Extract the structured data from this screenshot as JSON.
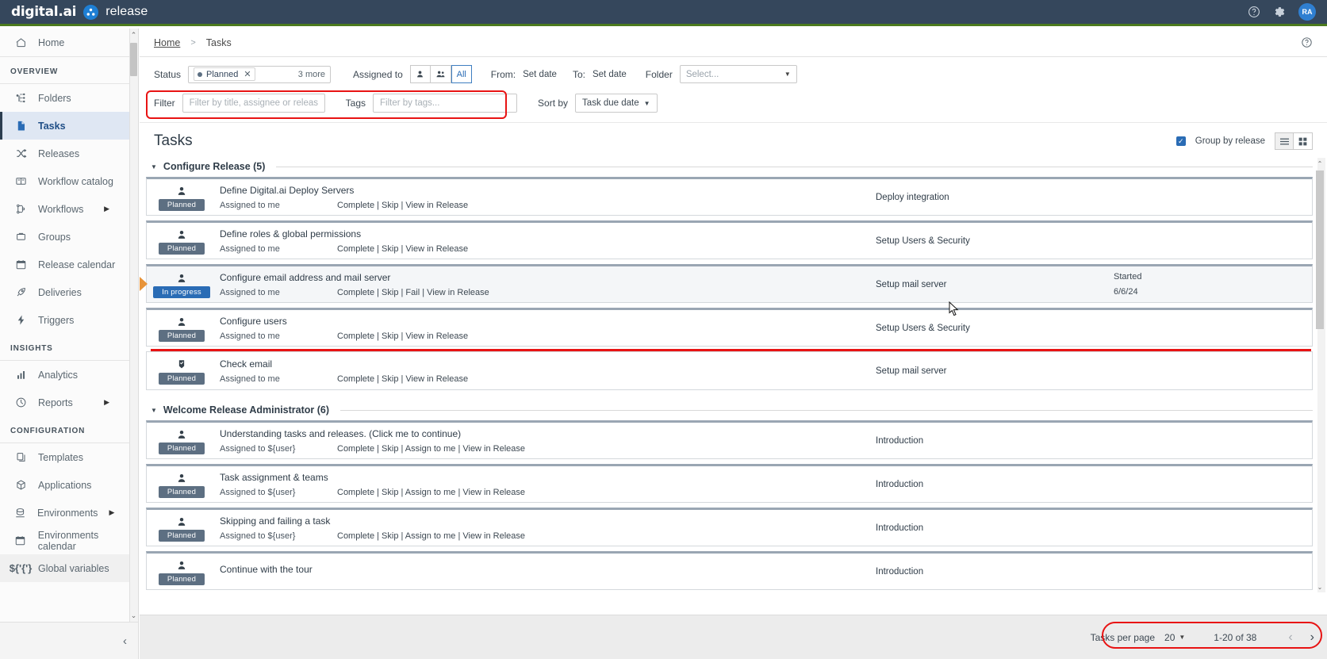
{
  "topbar": {
    "brand_primary": "digital.ai",
    "brand_product": "release",
    "icons": {
      "help": "help-icon",
      "settings": "gear-icon"
    },
    "avatar_initials": "RA"
  },
  "sidebar": {
    "home_label": "Home",
    "sections": [
      {
        "title": "OVERVIEW",
        "items": [
          {
            "label": "Folders",
            "icon": "folders-icon",
            "active": false,
            "expandable": false
          },
          {
            "label": "Tasks",
            "icon": "tasks-icon",
            "active": true,
            "expandable": false
          },
          {
            "label": "Releases",
            "icon": "releases-icon",
            "active": false,
            "expandable": false
          },
          {
            "label": "Workflow catalog",
            "icon": "book-icon",
            "active": false,
            "expandable": false
          },
          {
            "label": "Workflows",
            "icon": "workflows-icon",
            "active": false,
            "expandable": true
          },
          {
            "label": "Groups",
            "icon": "groups-icon",
            "active": false,
            "expandable": false
          },
          {
            "label": "Release calendar",
            "icon": "calendar-icon",
            "active": false,
            "expandable": false
          },
          {
            "label": "Deliveries",
            "icon": "rocket-icon",
            "active": false,
            "expandable": false
          },
          {
            "label": "Triggers",
            "icon": "bolt-icon",
            "active": false,
            "expandable": false
          }
        ]
      },
      {
        "title": "INSIGHTS",
        "items": [
          {
            "label": "Analytics",
            "icon": "bar-chart-icon",
            "active": false,
            "expandable": false
          },
          {
            "label": "Reports",
            "icon": "report-icon",
            "active": false,
            "expandable": true
          }
        ]
      },
      {
        "title": "CONFIGURATION",
        "items": [
          {
            "label": "Templates",
            "icon": "templates-icon",
            "active": false,
            "expandable": false
          },
          {
            "label": "Applications",
            "icon": "cube-icon",
            "active": false,
            "expandable": false
          },
          {
            "label": "Environments",
            "icon": "environments-icon",
            "active": false,
            "expandable": true
          },
          {
            "label": "Environments calendar",
            "icon": "calendar-icon",
            "active": false,
            "expandable": false
          },
          {
            "label": "Global variables",
            "icon": "variables-icon",
            "active": false,
            "expandable": false
          }
        ]
      }
    ],
    "collapse_icon": "chevron-left-icon"
  },
  "breadcrumb": {
    "home": "Home",
    "separator": ">",
    "current": "Tasks",
    "help_icon": "help-icon"
  },
  "filters": {
    "status_label": "Status",
    "status_chip": "Planned",
    "status_more": "3 more",
    "assigned_label": "Assigned to",
    "assigned_options": [
      "person-icon",
      "people-icon",
      "All"
    ],
    "assigned_selected": "All",
    "from_label": "From:",
    "from_value": "Set date",
    "to_label": "To:",
    "to_value": "Set date",
    "folder_label": "Folder",
    "folder_placeholder": "Select...",
    "filter_label": "Filter",
    "filter_placeholder": "Filter by title, assignee or release...",
    "filter_value": "",
    "tags_label": "Tags",
    "tags_placeholder": "Filter by tags...",
    "tags_value": "",
    "sort_label": "Sort by",
    "sort_value": "Task due date"
  },
  "tasks_panel": {
    "title": "Tasks",
    "group_by_release_label": "Group by release",
    "group_by_release_checked": true,
    "view_list_icon": "list-view-icon",
    "view_grid_icon": "grid-view-icon",
    "view_selected": "list"
  },
  "groups": [
    {
      "name": "Configure Release (5)",
      "tasks": [
        {
          "title": "Define Digital.ai Deploy Servers",
          "status": "Planned",
          "assigned": "Assigned to me",
          "actions": "Complete | Skip | View in Release",
          "release": "Deploy integration",
          "date_label": "",
          "date_value": "",
          "icon": "person-task-icon",
          "highlight": false
        },
        {
          "title": "Define roles & global permissions",
          "status": "Planned",
          "assigned": "Assigned to me",
          "actions": "Complete | Skip | View in Release",
          "release": "Setup Users & Security",
          "date_label": "",
          "date_value": "",
          "icon": "person-task-icon",
          "highlight": false
        },
        {
          "title": "Configure email address and mail server",
          "status": "In progress",
          "assigned": "Assigned to me",
          "actions": "Complete | Skip | Fail | View in Release",
          "release": "Setup mail server",
          "date_label": "Started",
          "date_value": "6/6/24",
          "icon": "person-task-icon",
          "highlight": true
        },
        {
          "title": "Configure users",
          "status": "Planned",
          "assigned": "Assigned to me",
          "actions": "Complete | Skip | View in Release",
          "release": "Setup Users & Security",
          "date_label": "",
          "date_value": "",
          "icon": "person-task-icon",
          "highlight": false
        },
        {
          "title": "Check email",
          "status": "Planned",
          "assigned": "Assigned to me",
          "actions": "Complete | Skip | View in Release",
          "release": "Setup mail server",
          "date_label": "",
          "date_value": "",
          "icon": "manual-task-icon",
          "highlight": false
        }
      ]
    },
    {
      "name": "Welcome Release Administrator (6)",
      "tasks": [
        {
          "title": "Understanding tasks and releases. (Click me to continue)",
          "status": "Planned",
          "assigned": "Assigned to ${user}",
          "actions": "Complete | Skip | Assign to me | View in Release",
          "release": "Introduction",
          "date_label": "",
          "date_value": "",
          "icon": "person-task-icon",
          "highlight": false
        },
        {
          "title": "Task assignment & teams",
          "status": "Planned",
          "assigned": "Assigned to ${user}",
          "actions": "Complete | Skip | Assign to me | View in Release",
          "release": "Introduction",
          "date_label": "",
          "date_value": "",
          "icon": "person-task-icon",
          "highlight": false
        },
        {
          "title": "Skipping and failing a task",
          "status": "Planned",
          "assigned": "Assigned to ${user}",
          "actions": "Complete | Skip | Assign to me | View in Release",
          "release": "Introduction",
          "date_label": "",
          "date_value": "",
          "icon": "person-task-icon",
          "highlight": false
        },
        {
          "title": "Continue with the tour",
          "status": "Planned",
          "assigned": "",
          "actions": "",
          "release": "Introduction",
          "date_label": "",
          "date_value": "",
          "icon": "person-task-icon",
          "highlight": false
        }
      ]
    }
  ],
  "pagination": {
    "per_page_label": "Tasks per page",
    "per_page_value": "20",
    "range_text": "1-20 of 38",
    "prev_icon": "chevron-left-icon",
    "next_icon": "chevron-right-icon"
  },
  "colors": {
    "topbar_bg": "#35475c",
    "accent_green": "#4b7a1e",
    "accent_blue": "#2a6cb5",
    "badge_gray": "#5d6f82",
    "annotation_red": "#e81313",
    "arrow_orange": "#e8943a"
  }
}
